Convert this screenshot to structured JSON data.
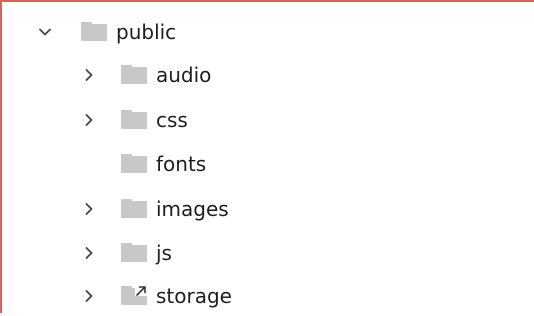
{
  "tree": {
    "root": {
      "label": "public",
      "expanded": true,
      "icon": "folder-icon"
    },
    "children": [
      {
        "label": "audio",
        "expandable": true,
        "icon": "folder-icon"
      },
      {
        "label": "css",
        "expandable": true,
        "icon": "folder-icon"
      },
      {
        "label": "fonts",
        "expandable": false,
        "icon": "folder-icon"
      },
      {
        "label": "images",
        "expandable": true,
        "icon": "folder-icon"
      },
      {
        "label": "js",
        "expandable": true,
        "icon": "folder-icon"
      },
      {
        "label": "storage",
        "expandable": true,
        "icon": "folder-symlink-icon"
      }
    ]
  },
  "colors": {
    "folder": "#c8c8c8",
    "chevron": "#444444",
    "text": "#1e1e1e",
    "border": "#d9625a",
    "symlink_arrow": "#333333"
  }
}
